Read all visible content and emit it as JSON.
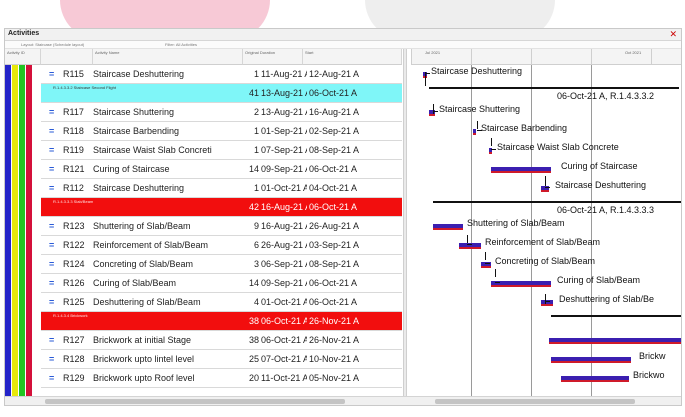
{
  "window": {
    "title": "Activities",
    "close_icon": "close-icon"
  },
  "options": {
    "layout": "Layout: Staircase (Schedule layout)",
    "filter": "Filter: All Activities"
  },
  "columns": {
    "id": "Activity ID",
    "name": "Activity Name",
    "duration": "Original Duration",
    "start": "Start"
  },
  "gantt_header": {
    "left_month": "Jul 2021",
    "right_month": "Oct 2021"
  },
  "band_colors": [
    "#2323c8",
    "#e8e80a",
    "#22c422",
    "#d4103a"
  ],
  "rows": [
    {
      "type": "activity",
      "id": "R115",
      "name": "Staircase Deshuttering",
      "duration": "1",
      "start": "11-Aug-21 A",
      "finish": "12-Aug-21 A"
    },
    {
      "type": "wbs",
      "style": "cyan",
      "name": "R.1.4.3.3.2 Staircase Second Flight",
      "duration": "41",
      "start": "13-Aug-21 A",
      "finish": "06-Oct-21 A"
    },
    {
      "type": "activity",
      "id": "R117",
      "name": "Staircase Shuttering",
      "duration": "2",
      "start": "13-Aug-21 A",
      "finish": "16-Aug-21 A"
    },
    {
      "type": "activity",
      "id": "R118",
      "name": "Staircase Barbending",
      "duration": "1",
      "start": "01-Sep-21 A",
      "finish": "02-Sep-21 A"
    },
    {
      "type": "activity",
      "id": "R119",
      "name": "Staircase Waist Slab Concreti",
      "duration": "1",
      "start": "07-Sep-21 A",
      "finish": "08-Sep-21 A"
    },
    {
      "type": "activity",
      "id": "R121",
      "name": "Curing of Staircase",
      "duration": "14",
      "start": "09-Sep-21 A",
      "finish": "06-Oct-21 A"
    },
    {
      "type": "activity",
      "id": "R112",
      "name": "Staircase Deshuttering",
      "duration": "1",
      "start": "01-Oct-21 A",
      "finish": "04-Oct-21 A"
    },
    {
      "type": "wbs",
      "style": "red",
      "name": "R.1.4.3.3.3 Slab/Beam",
      "duration": "42",
      "start": "16-Aug-21 A",
      "finish": "06-Oct-21 A"
    },
    {
      "type": "activity",
      "id": "R123",
      "name": "Shuttering of Slab/Beam",
      "duration": "9",
      "start": "16-Aug-21 A",
      "finish": "26-Aug-21 A"
    },
    {
      "type": "activity",
      "id": "R122",
      "name": "Reinforcement of Slab/Beam",
      "duration": "6",
      "start": "26-Aug-21 A",
      "finish": "03-Sep-21 A"
    },
    {
      "type": "activity",
      "id": "R124",
      "name": "Concreting of Slab/Beam",
      "duration": "3",
      "start": "06-Sep-21 A",
      "finish": "08-Sep-21 A"
    },
    {
      "type": "activity",
      "id": "R126",
      "name": "Curing of Slab/Beam",
      "duration": "14",
      "start": "09-Sep-21 A",
      "finish": "06-Oct-21 A"
    },
    {
      "type": "activity",
      "id": "R125",
      "name": "Deshuttering of Slab/Beam",
      "duration": "4",
      "start": "01-Oct-21 A",
      "finish": "06-Oct-21 A"
    },
    {
      "type": "wbs",
      "style": "red",
      "name": "R.1.4.3.4 Brickwork",
      "duration": "38",
      "start": "06-Oct-21 A",
      "finish": "26-Nov-21 A"
    },
    {
      "type": "activity",
      "id": "R127",
      "name": "Brickwork at initial Stage",
      "duration": "38",
      "start": "06-Oct-21 A",
      "finish": "26-Nov-21 A"
    },
    {
      "type": "activity",
      "id": "R128",
      "name": "Brickwork upto lintel level",
      "duration": "25",
      "start": "07-Oct-21 A",
      "finish": "10-Nov-21 A"
    },
    {
      "type": "activity",
      "id": "R129",
      "name": "Brickwork upto Roof level",
      "duration": "20",
      "start": "11-Oct-21 A",
      "finish": "05-Nov-21 A"
    }
  ],
  "gantt_labels": {
    "r0": "Staircase Deshuttering",
    "r1": "06-Oct-21 A, R.1.4.3.3.2",
    "r2": "Staircase Shuttering",
    "r3": "Staircase Barbending",
    "r4": "Staircase Waist Slab Concrete",
    "r5": "Curing of Staircase",
    "r6": "Staircase Deshuttering",
    "r7": "06-Oct-21 A, R.1.4.3.3.3",
    "r8": "Shuttering of Slab/Beam",
    "r9": "Reinforcement of Slab/Beam",
    "r10": "Concreting of Slab/Beam",
    "r11": "Curing of Slab/Beam",
    "r12": "Deshuttering of Slab/Be",
    "r15": "Brickw",
    "r16": "Brickwo"
  }
}
